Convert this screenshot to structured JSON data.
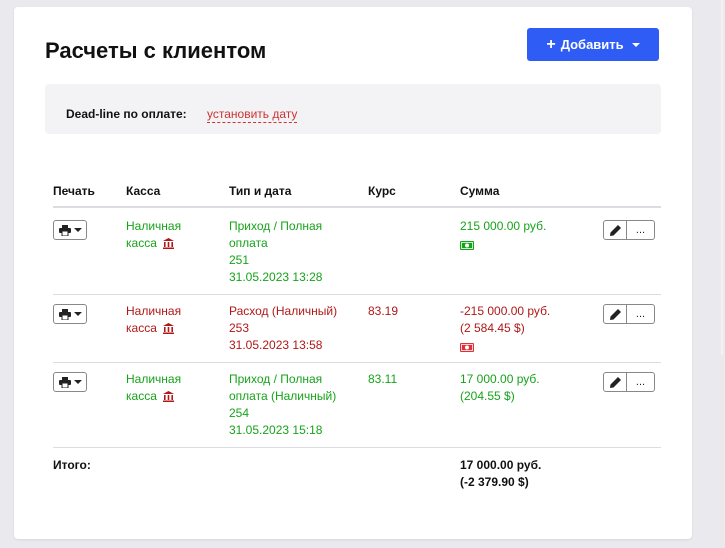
{
  "page": {
    "title": "Расчеты с клиентом"
  },
  "add_button": {
    "label": "Добавить"
  },
  "deadline": {
    "label": "Dead-line по оплате:",
    "link": "установить дату"
  },
  "table": {
    "headers": {
      "print": "Печать",
      "kassa": "Касса",
      "type": "Тип и дата",
      "rate": "Курс",
      "sum": "Сумма"
    },
    "rows": [
      {
        "kassa_line1": "Наличная",
        "kassa_line2": "касса",
        "type_line1": "Приход / Полная",
        "type_line2": "оплата",
        "type_line3": "251",
        "type_line4": "31.05.2023 13:28",
        "rate": "",
        "sum_line1": "215 000.00 руб.",
        "sum_line2": "",
        "status": "income"
      },
      {
        "kassa_line1": "Наличная",
        "kassa_line2": "касса",
        "type_line1": "Расход (Наличный)",
        "type_line2": "253",
        "type_line3": "31.05.2023 13:58",
        "type_line4": "",
        "rate": "83.19",
        "sum_line1": "-215 000.00 руб.",
        "sum_line2": "(2 584.45 $)",
        "status": "expense"
      },
      {
        "kassa_line1": "Наличная",
        "kassa_line2": "касса",
        "type_line1": "Приход / Полная",
        "type_line2": "оплата (Наличный)",
        "type_line3": "254",
        "type_line4": "31.05.2023 15:18",
        "rate": "83.11",
        "sum_line1": "17 000.00 руб.",
        "sum_line2": "(204.55 $)",
        "status": "income"
      }
    ],
    "total": {
      "label": "Итого:",
      "line1": "17 000.00 руб.",
      "line2": "(-2 379.90 $)"
    }
  },
  "icons": {
    "print": "printer-icon",
    "edit": "pencil-icon",
    "more": "ellipsis-icon",
    "bank": "bank-icon",
    "money": "banknote-icon",
    "plus": "plus-icon",
    "caret": "caret-down-icon"
  },
  "colors": {
    "accent": "#2f5cf5",
    "income": "#16a31a",
    "expense": "#b01818",
    "link": "#cc3333"
  },
  "actions": {
    "more_label": "..."
  }
}
